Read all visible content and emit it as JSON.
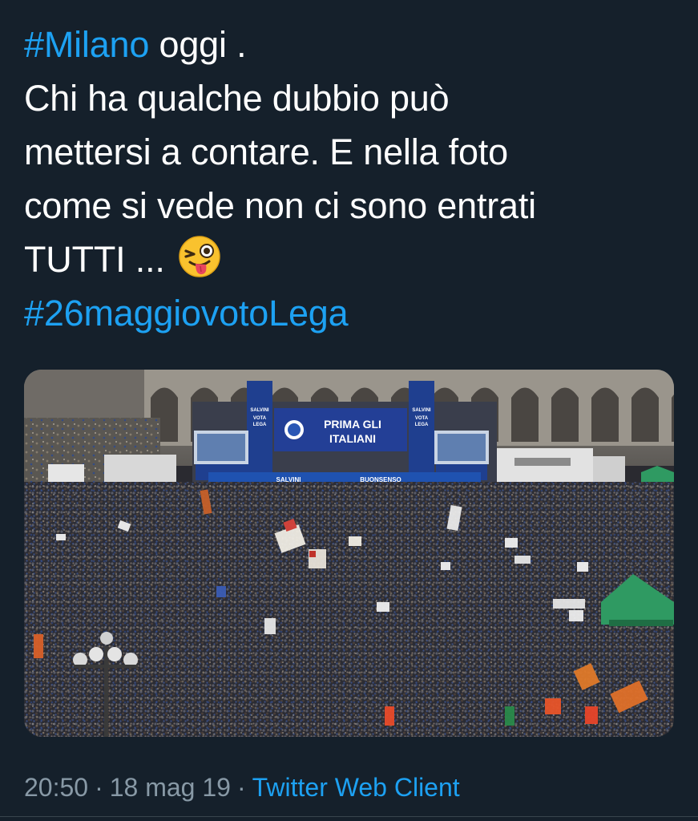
{
  "tweet": {
    "hashtag_city": "#Milano",
    "line1_rest": " oggi .",
    "line2": "Chi ha qualche dubbio può",
    "line3": "mettersi a contare. E nella foto",
    "line4": "come si vede non ci sono entrati",
    "line5": "TUTTI ... ",
    "emoji": "winking-face-with-tongue-icon",
    "hashtag_vote": "#26maggiovotoLega"
  },
  "photo": {
    "stage_banner_line1": "PRIMA GLI",
    "stage_banner_line2": "ITALIANI",
    "tower_text": "SALVINI",
    "tower_text2": "VOTA",
    "tower_text3": "LEGA",
    "stage_front_left": "SALVINI",
    "stage_front_right": "BUONSENSO",
    "screen_caption": "PRIMA GLI ITALIANI"
  },
  "meta": {
    "time": "20:50",
    "separator": "·",
    "date": "18 mag 19",
    "client": "Twitter Web Client"
  },
  "colors": {
    "background": "#15202b",
    "link": "#1da1f2",
    "secondary": "#8899a6",
    "banner_blue": "#1f3f8f"
  }
}
